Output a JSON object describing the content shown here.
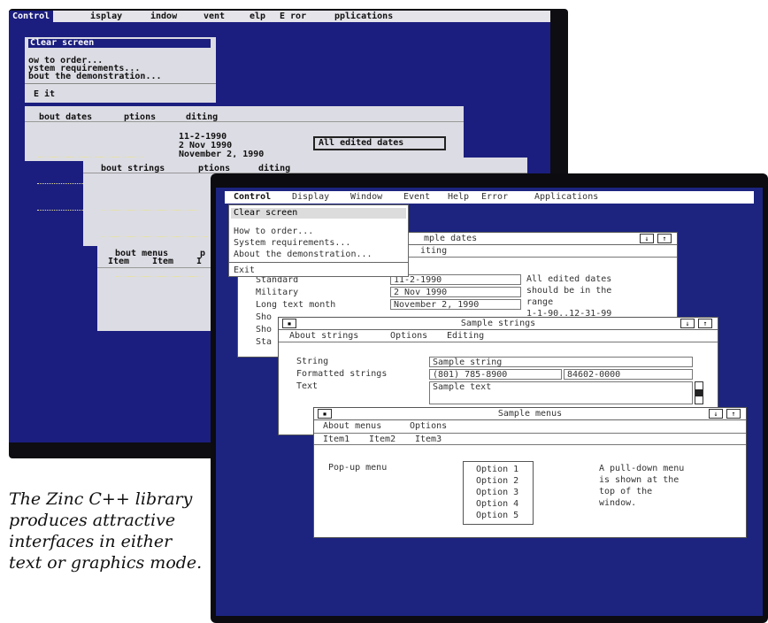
{
  "text_mode": {
    "menubar": [
      "Control",
      "isplay",
      "indow",
      "vent",
      "elp",
      "E ror",
      "pplications"
    ],
    "control_menu": {
      "selected": "Clear screen",
      "items": [
        "ow to order...",
        "ystem requirements...",
        "bout the demonstration..."
      ],
      "exit": "E it"
    },
    "dates_window": {
      "menu": [
        "bout dates",
        "ptions",
        "diting"
      ],
      "values": [
        "11-2-1990",
        "2 Nov 1990",
        "November 2, 1990"
      ],
      "note": "All edited dates"
    },
    "strings_window": {
      "menu": [
        "bout strings",
        "ptions",
        "diting"
      ]
    },
    "menus_window": {
      "menu": [
        "bout menus",
        "p"
      ],
      "items": [
        "Item",
        "Item",
        "I"
      ]
    }
  },
  "graphics_mode": {
    "menubar": [
      "Control",
      "Display",
      "Window",
      "Event",
      "Help",
      "Error",
      "Applications"
    ],
    "control_menu": {
      "selected": "Clear screen",
      "items": [
        "How to order...",
        "System requirements...",
        "About the demonstration..."
      ],
      "exit": "Exit"
    },
    "dates_window": {
      "title": "mple dates",
      "menu": "iting",
      "labels": [
        "Standard",
        "Military",
        "Long text month",
        "Sho",
        "Sho",
        "Sta"
      ],
      "values": [
        "11-2-1990",
        "2 Nov 1990",
        "November 2, 1990"
      ],
      "note": [
        "All edited dates",
        "should be in the",
        "range",
        "1-1-90..12-31-99"
      ]
    },
    "strings_window": {
      "title": "Sample strings",
      "menu": [
        "About strings",
        "Options",
        "Editing"
      ],
      "labels": [
        "String",
        "Formatted strings",
        "Text"
      ],
      "string_value": "Sample string",
      "phone_value": "(801) 785-8900",
      "zip_value": "84602-0000",
      "text_value": "Sample text"
    },
    "menus_window": {
      "title": "Sample menus",
      "menu": [
        "About menus",
        "Options"
      ],
      "items": [
        "Item1",
        "Item2",
        "Item3"
      ],
      "popup_label": "Pop-up menu",
      "options": [
        "Option 1",
        "Option 2",
        "Option 3",
        "Option 4",
        "Option 5"
      ],
      "note": [
        "A pull-down menu",
        "is shown at the",
        "top of the",
        "window."
      ]
    },
    "button_glyphs": {
      "close": "▪",
      "minimize": "↓",
      "maximize": "↑"
    }
  },
  "caption": "The Zinc C++ library produces attractive interfaces in either text or graphics mode."
}
